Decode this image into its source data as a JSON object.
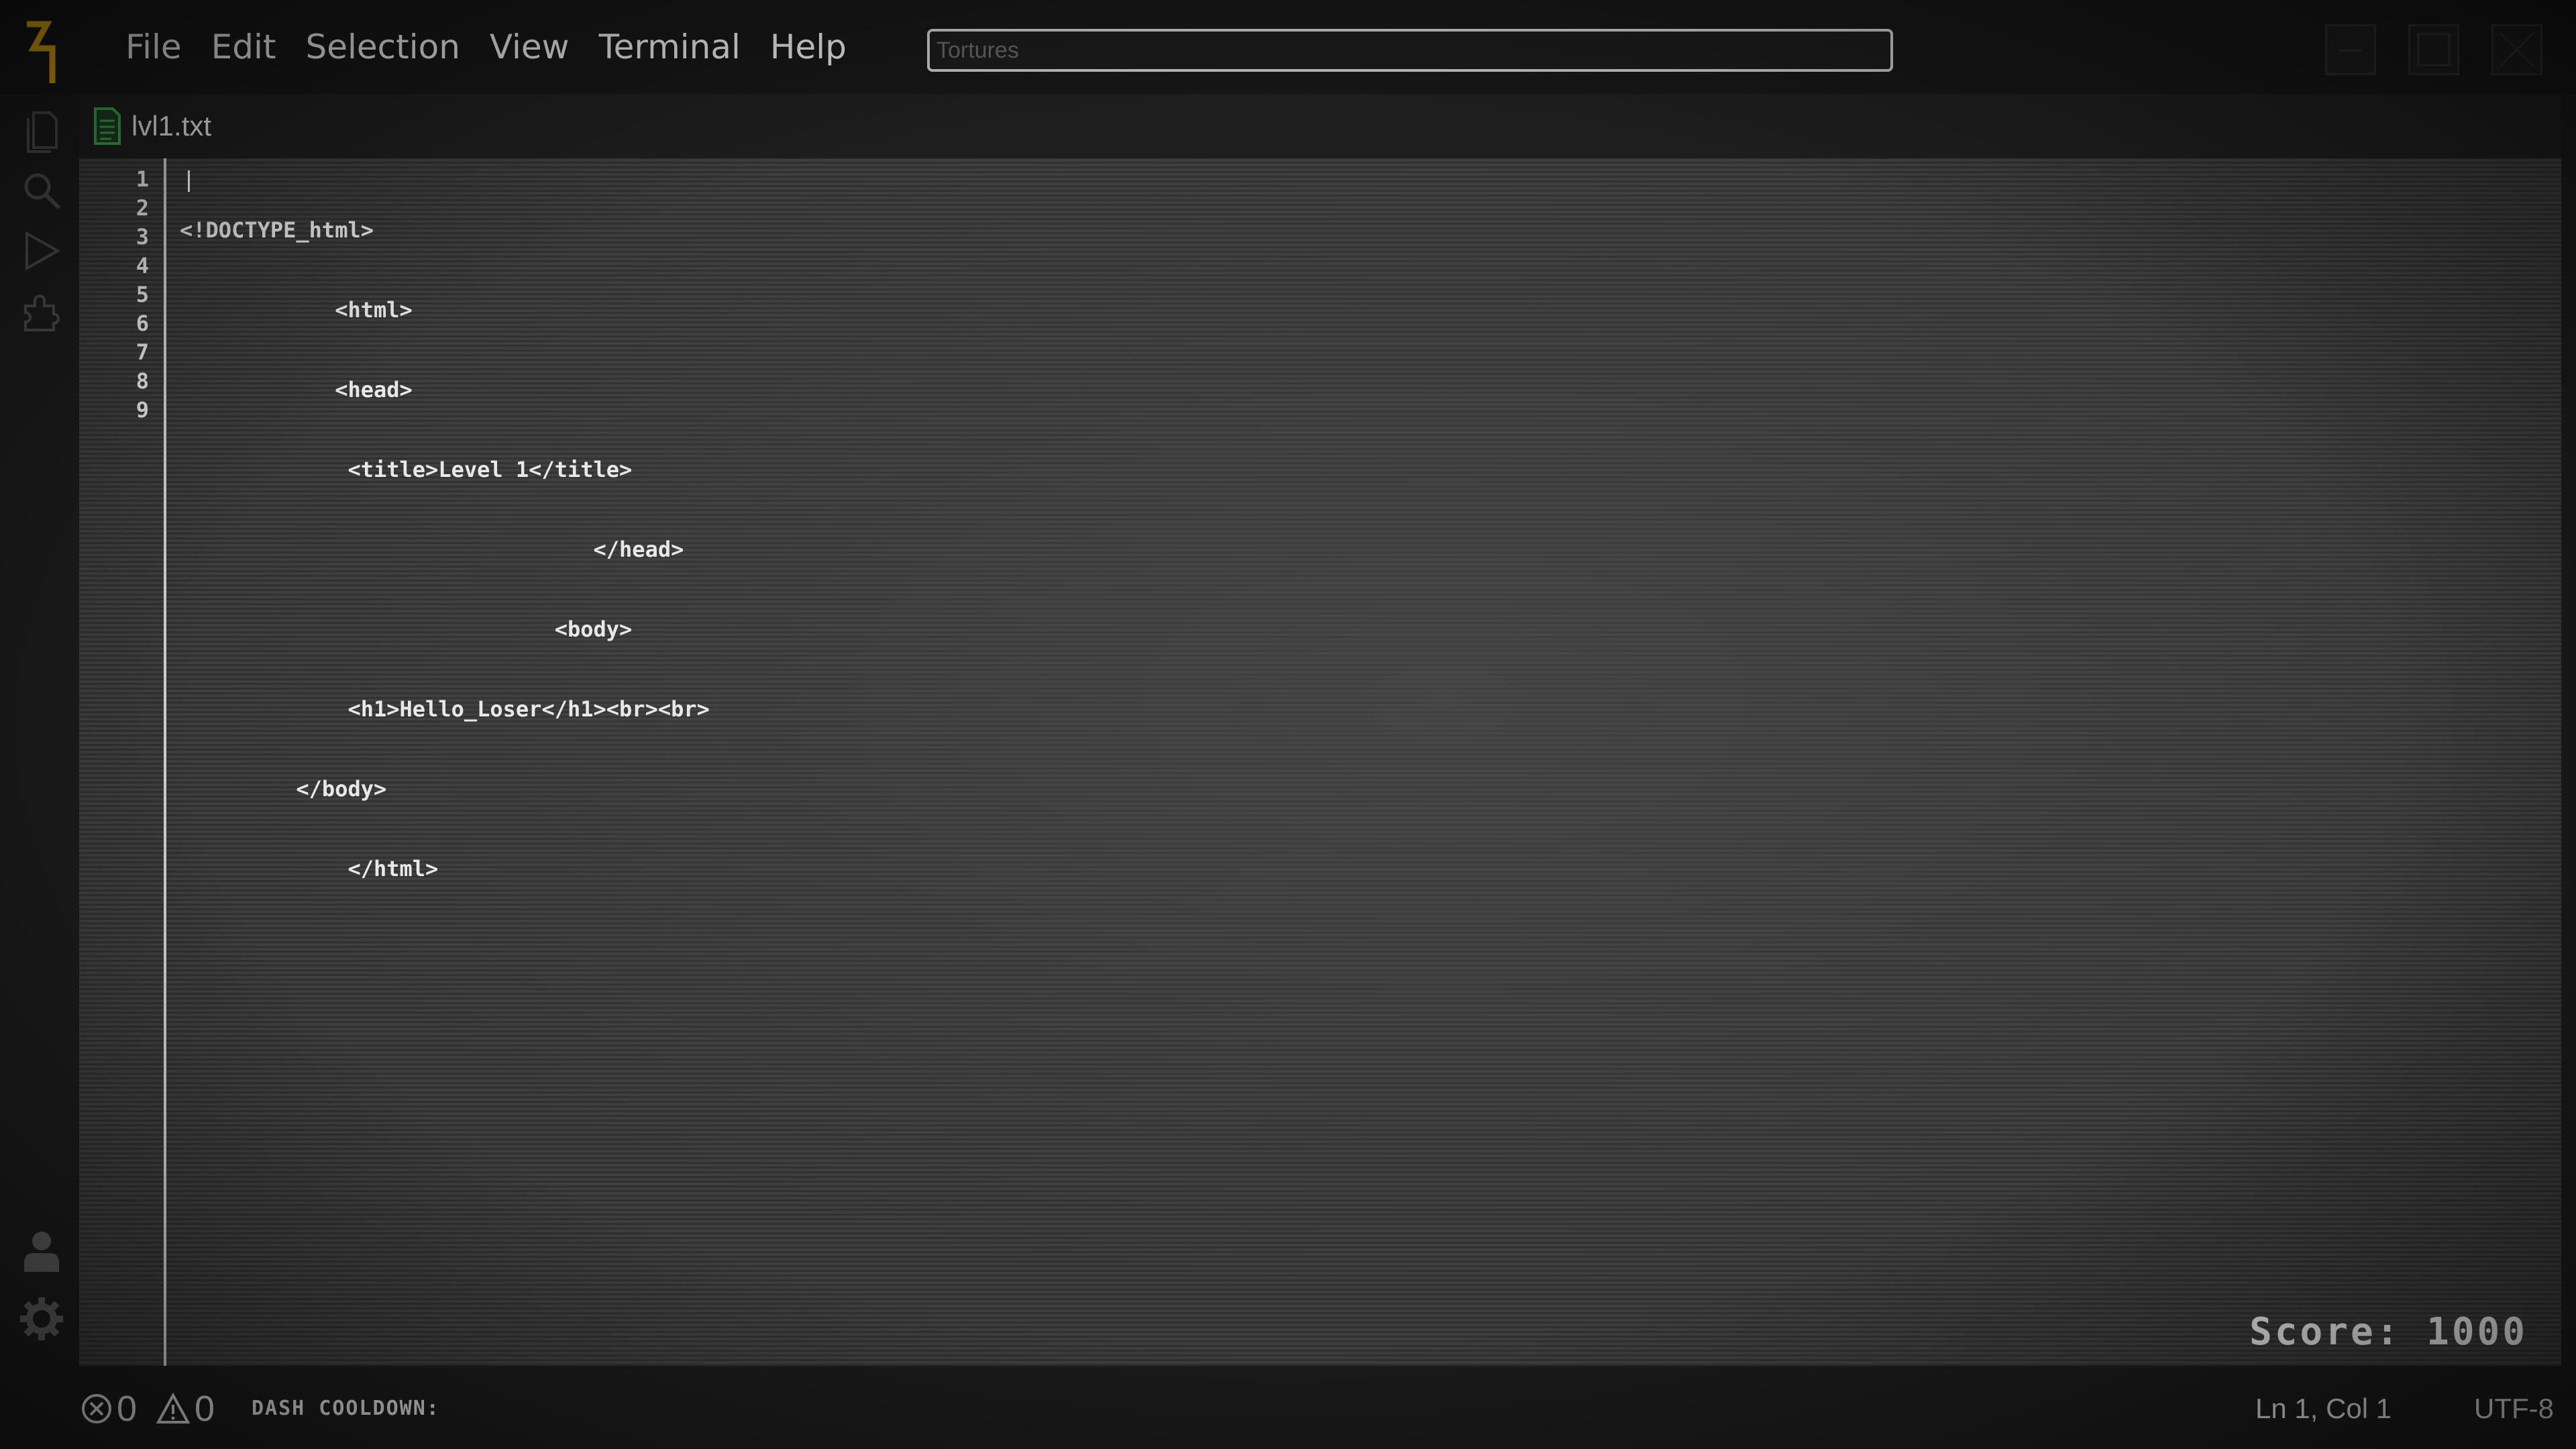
{
  "menu": {
    "items": [
      "File",
      "Edit",
      "Selection",
      "View",
      "Terminal",
      "Help"
    ]
  },
  "search": {
    "placeholder": "Tortures",
    "value": ""
  },
  "tab": {
    "filename": "lvl1.txt",
    "icon": "text-file-icon"
  },
  "editor": {
    "line_numbers": [
      "1",
      "2",
      "3",
      "4",
      "5",
      "6",
      "7",
      "8",
      "9"
    ],
    "lines": [
      "<!DOCTYPE_html>",
      "            <html>",
      "            <head>",
      "             <title>Level 1</title>",
      "                                </head>",
      "                             <body>",
      "             <h1>Hello_Loser</h1><br><br>",
      "         </body>",
      "             </html>"
    ]
  },
  "game": {
    "score_text": "Score: 1000"
  },
  "status": {
    "errors": "0",
    "warnings": "0",
    "dash_cooldown": "DASH COOLDOWN:",
    "cursor_position": "Ln 1, Col 1",
    "encoding": "UTF-8"
  },
  "colors": {
    "logo_accent": "#d4a017",
    "file_icon": "#3fa34d",
    "background": "#1b1b1b",
    "editor_bg": "#3a3a3a"
  }
}
